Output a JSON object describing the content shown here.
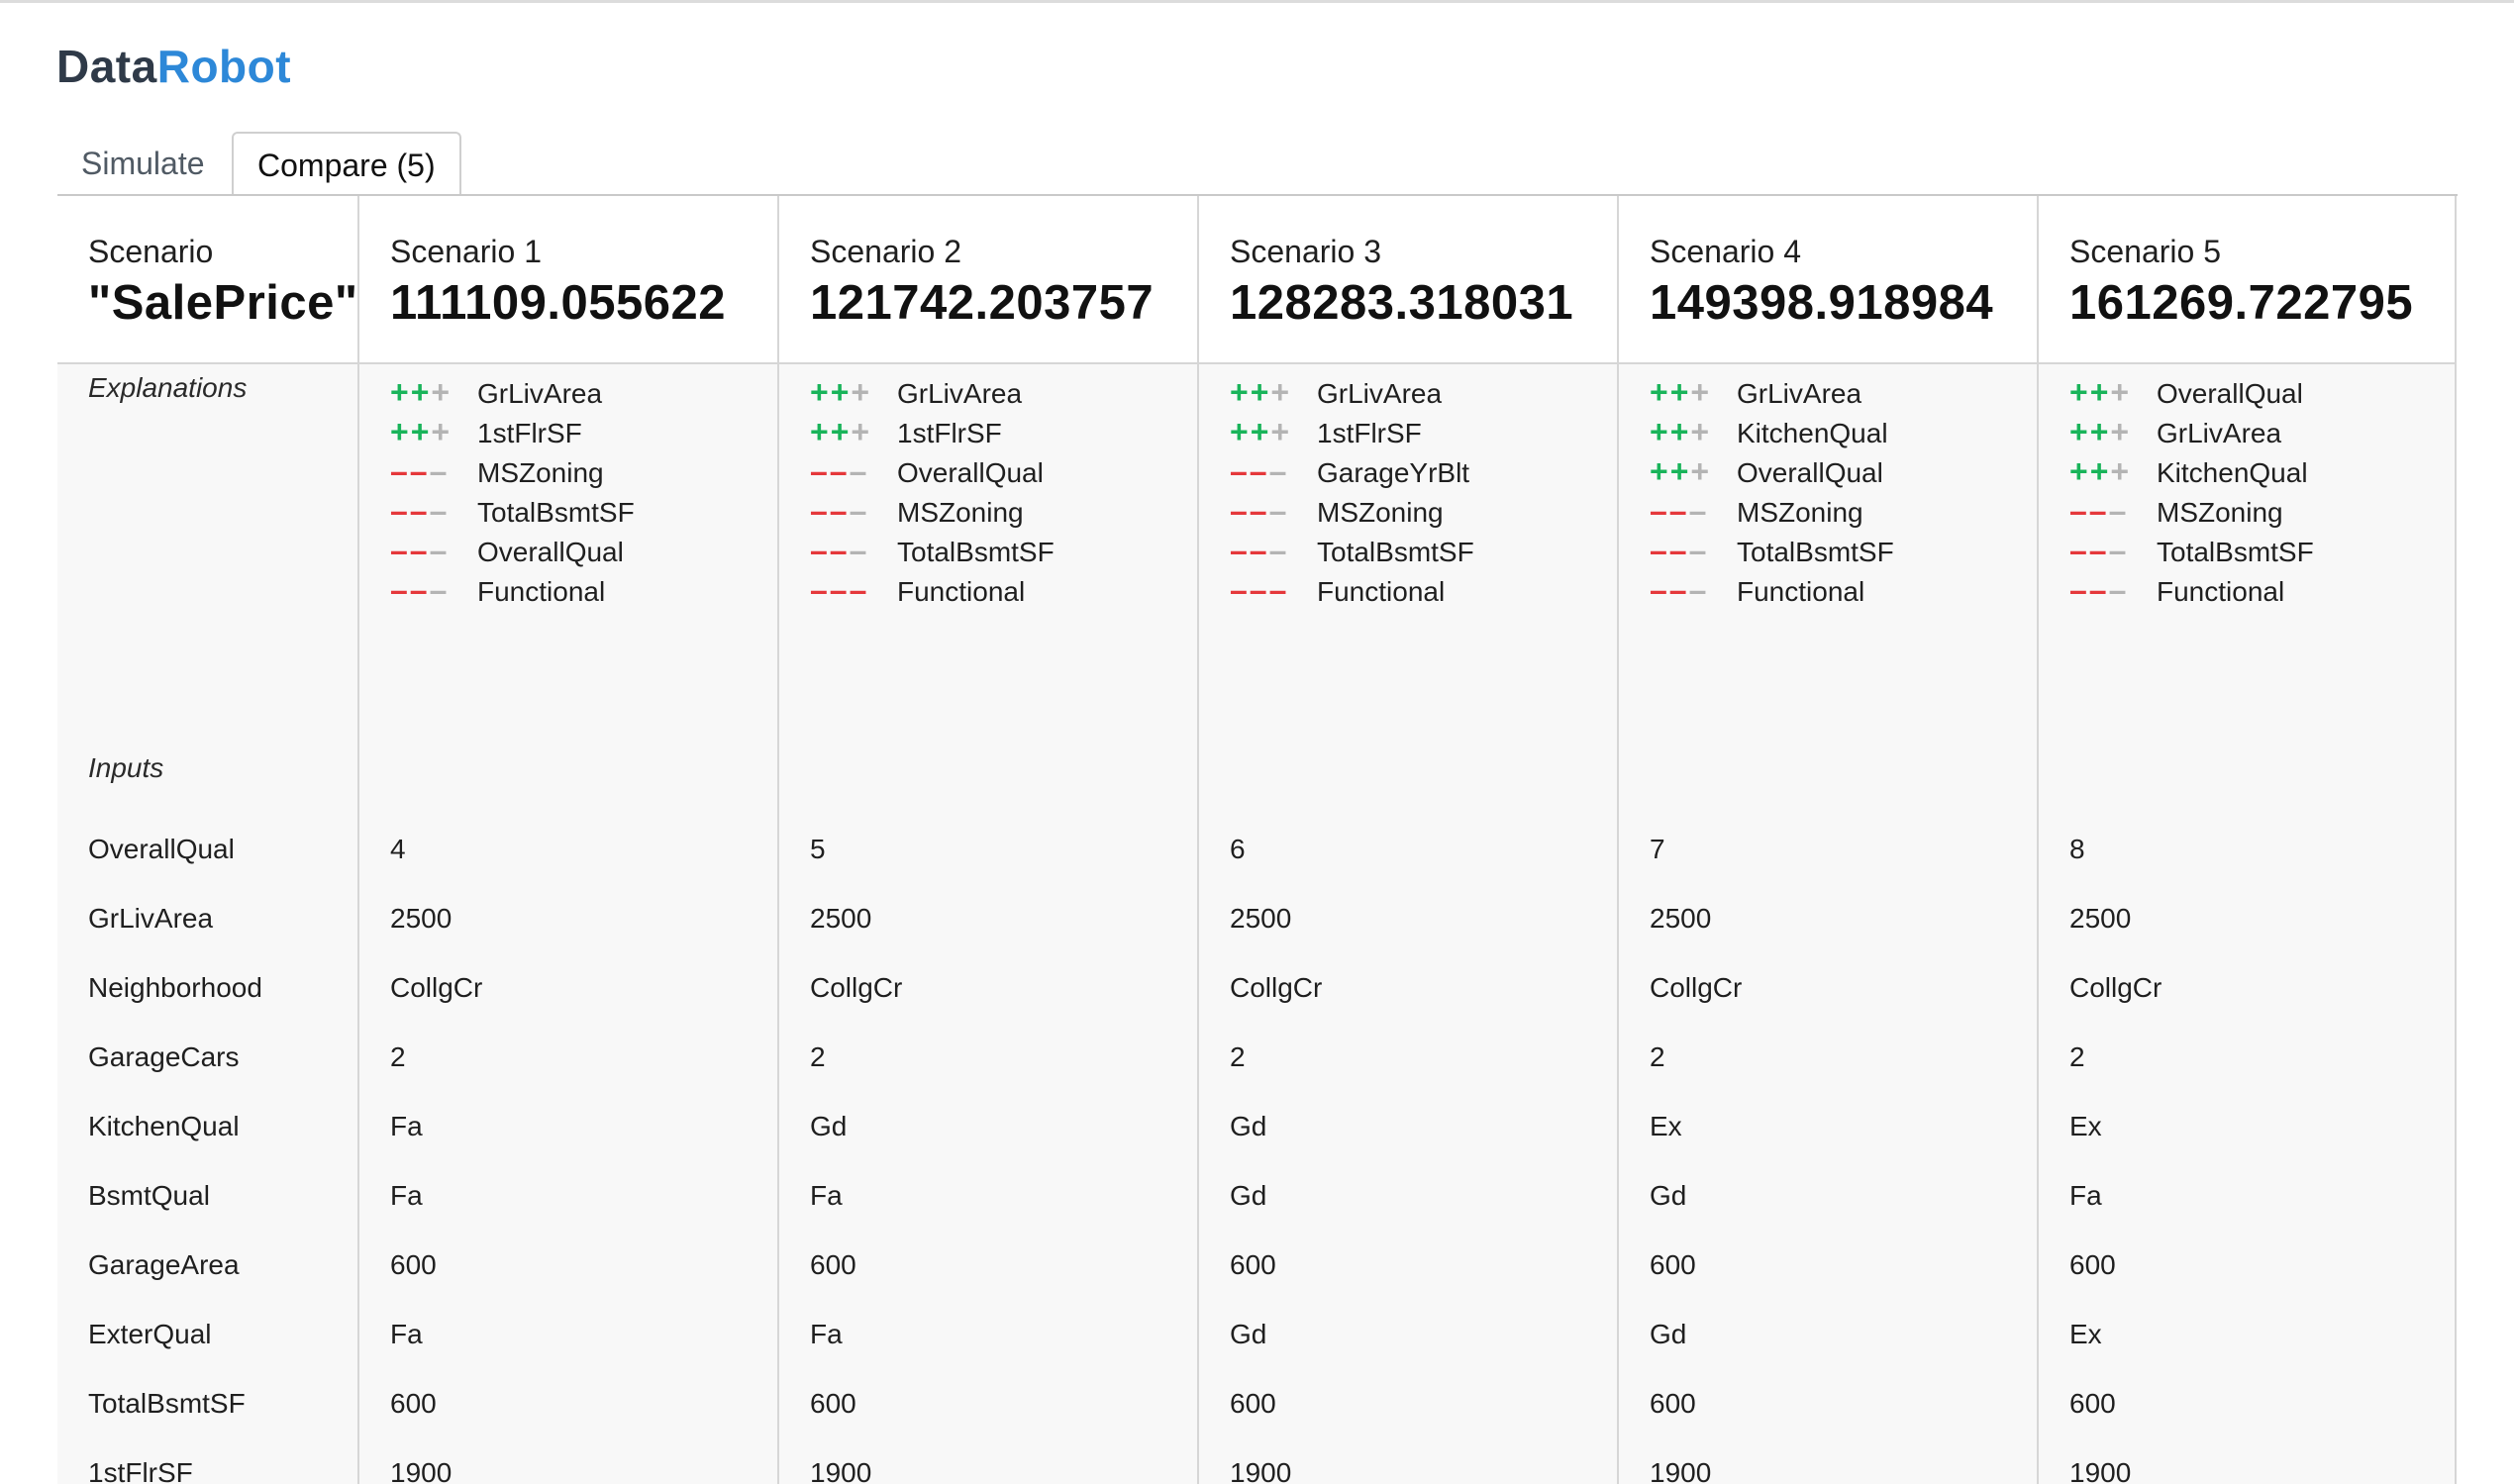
{
  "logo": {
    "part1": "Data",
    "part2": "Robot"
  },
  "tabs": [
    {
      "label": "Simulate"
    },
    {
      "label": "Compare (5)"
    }
  ],
  "label_column": {
    "header_small": "Scenario",
    "header_big": "\"SalePrice\"",
    "explanations_label": "Explanations",
    "inputs_label": "Inputs",
    "input_names": [
      "OverallQual",
      "GrLivArea",
      "Neighborhood",
      "GarageCars",
      "KitchenQual",
      "BsmtQual",
      "GarageArea",
      "ExterQual",
      "TotalBsmtSF",
      "1stFlrSF"
    ]
  },
  "colors": {
    "positive": "#19b45a",
    "negative": "#e5383b",
    "neutral": "#b4b4b4",
    "brand": "#2d88d8"
  },
  "scenarios": [
    {
      "name": "Scenario 1",
      "prediction": "111109.055622",
      "explanations": [
        {
          "direction": "positive",
          "strength": 2,
          "feature": "GrLivArea"
        },
        {
          "direction": "positive",
          "strength": 2,
          "feature": "1stFlrSF"
        },
        {
          "direction": "negative",
          "strength": 2,
          "feature": "MSZoning"
        },
        {
          "direction": "negative",
          "strength": 2,
          "feature": "TotalBsmtSF"
        },
        {
          "direction": "negative",
          "strength": 2,
          "feature": "OverallQual"
        },
        {
          "direction": "negative",
          "strength": 2,
          "feature": "Functional"
        }
      ],
      "inputs": [
        "4",
        "2500",
        "CollgCr",
        "2",
        "Fa",
        "Fa",
        "600",
        "Fa",
        "600",
        "1900"
      ]
    },
    {
      "name": "Scenario 2",
      "prediction": "121742.203757",
      "explanations": [
        {
          "direction": "positive",
          "strength": 2,
          "feature": "GrLivArea"
        },
        {
          "direction": "positive",
          "strength": 2,
          "feature": "1stFlrSF"
        },
        {
          "direction": "negative",
          "strength": 2,
          "feature": "OverallQual"
        },
        {
          "direction": "negative",
          "strength": 2,
          "feature": "MSZoning"
        },
        {
          "direction": "negative",
          "strength": 2,
          "feature": "TotalBsmtSF"
        },
        {
          "direction": "negative",
          "strength": 3,
          "feature": "Functional"
        }
      ],
      "inputs": [
        "5",
        "2500",
        "CollgCr",
        "2",
        "Gd",
        "Fa",
        "600",
        "Fa",
        "600",
        "1900"
      ]
    },
    {
      "name": "Scenario 3",
      "prediction": "128283.318031",
      "explanations": [
        {
          "direction": "positive",
          "strength": 2,
          "feature": "GrLivArea"
        },
        {
          "direction": "positive",
          "strength": 2,
          "feature": "1stFlrSF"
        },
        {
          "direction": "negative",
          "strength": 2,
          "feature": "GarageYrBlt"
        },
        {
          "direction": "negative",
          "strength": 2,
          "feature": "MSZoning"
        },
        {
          "direction": "negative",
          "strength": 2,
          "feature": "TotalBsmtSF"
        },
        {
          "direction": "negative",
          "strength": 3,
          "feature": "Functional"
        }
      ],
      "inputs": [
        "6",
        "2500",
        "CollgCr",
        "2",
        "Gd",
        "Gd",
        "600",
        "Gd",
        "600",
        "1900"
      ]
    },
    {
      "name": "Scenario 4",
      "prediction": "149398.918984",
      "explanations": [
        {
          "direction": "positive",
          "strength": 2,
          "feature": "GrLivArea"
        },
        {
          "direction": "positive",
          "strength": 2,
          "feature": "KitchenQual"
        },
        {
          "direction": "positive",
          "strength": 2,
          "feature": "OverallQual"
        },
        {
          "direction": "negative",
          "strength": 2,
          "feature": "MSZoning"
        },
        {
          "direction": "negative",
          "strength": 2,
          "feature": "TotalBsmtSF"
        },
        {
          "direction": "negative",
          "strength": 2,
          "feature": "Functional"
        }
      ],
      "inputs": [
        "7",
        "2500",
        "CollgCr",
        "2",
        "Ex",
        "Gd",
        "600",
        "Gd",
        "600",
        "1900"
      ]
    },
    {
      "name": "Scenario 5",
      "prediction": "161269.722795",
      "explanations": [
        {
          "direction": "positive",
          "strength": 2,
          "feature": "OverallQual"
        },
        {
          "direction": "positive",
          "strength": 2,
          "feature": "GrLivArea"
        },
        {
          "direction": "positive",
          "strength": 2,
          "feature": "KitchenQual"
        },
        {
          "direction": "negative",
          "strength": 2,
          "feature": "MSZoning"
        },
        {
          "direction": "negative",
          "strength": 2,
          "feature": "TotalBsmtSF"
        },
        {
          "direction": "negative",
          "strength": 2,
          "feature": "Functional"
        }
      ],
      "inputs": [
        "8",
        "2500",
        "CollgCr",
        "2",
        "Ex",
        "Fa",
        "600",
        "Ex",
        "600",
        "1900"
      ]
    }
  ]
}
